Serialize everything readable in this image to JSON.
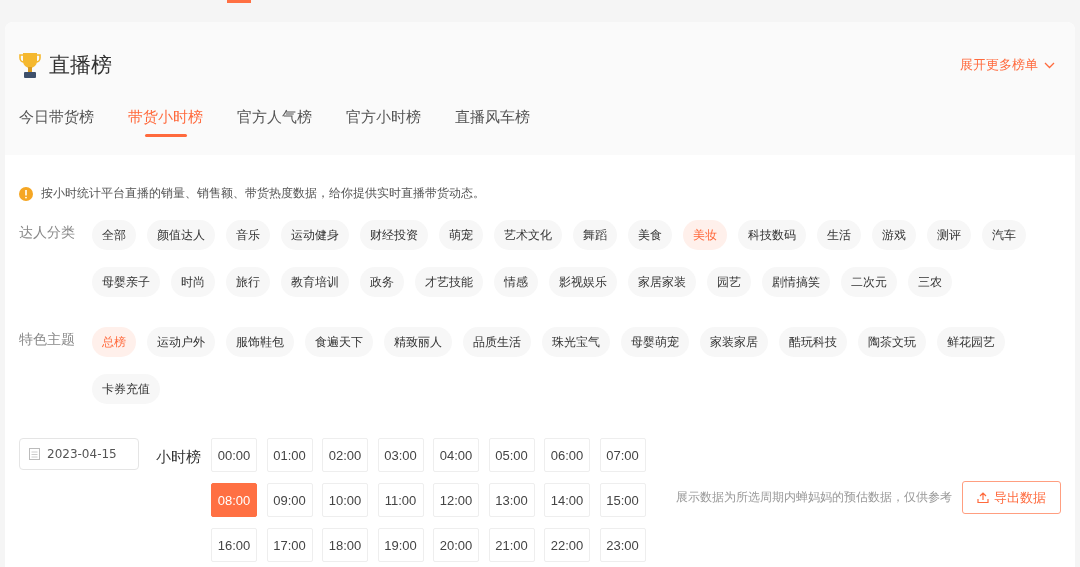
{
  "header": {
    "title": "直播榜",
    "more_link": "展开更多榜单"
  },
  "tabs": [
    {
      "label": "今日带货榜",
      "selected": false
    },
    {
      "label": "带货小时榜",
      "selected": true
    },
    {
      "label": "官方人气榜",
      "selected": false
    },
    {
      "label": "官方小时榜",
      "selected": false
    },
    {
      "label": "直播风车榜",
      "selected": false
    }
  ],
  "notice": "按小时统计平台直播的销量、销售额、带货热度数据，给你提供实时直播带货动态。",
  "filters": [
    {
      "label": "达人分类",
      "options": [
        {
          "label": "全部",
          "selected": false
        },
        {
          "label": "颜值达人",
          "selected": false
        },
        {
          "label": "音乐",
          "selected": false
        },
        {
          "label": "运动健身",
          "selected": false
        },
        {
          "label": "财经投资",
          "selected": false
        },
        {
          "label": "萌宠",
          "selected": false
        },
        {
          "label": "艺术文化",
          "selected": false
        },
        {
          "label": "舞蹈",
          "selected": false
        },
        {
          "label": "美食",
          "selected": false
        },
        {
          "label": "美妆",
          "selected": true
        },
        {
          "label": "科技数码",
          "selected": false
        },
        {
          "label": "生活",
          "selected": false
        },
        {
          "label": "游戏",
          "selected": false
        },
        {
          "label": "测评",
          "selected": false
        },
        {
          "label": "汽车",
          "selected": false
        },
        {
          "label": "母婴亲子",
          "selected": false
        },
        {
          "label": "时尚",
          "selected": false
        },
        {
          "label": "旅行",
          "selected": false
        },
        {
          "label": "教育培训",
          "selected": false
        },
        {
          "label": "政务",
          "selected": false
        },
        {
          "label": "才艺技能",
          "selected": false
        },
        {
          "label": "情感",
          "selected": false
        },
        {
          "label": "影视娱乐",
          "selected": false
        },
        {
          "label": "家居家装",
          "selected": false
        },
        {
          "label": "园艺",
          "selected": false
        },
        {
          "label": "剧情搞笑",
          "selected": false
        },
        {
          "label": "二次元",
          "selected": false
        },
        {
          "label": "三农",
          "selected": false
        }
      ]
    },
    {
      "label": "特色主题",
      "options": [
        {
          "label": "总榜",
          "selected": true
        },
        {
          "label": "运动户外",
          "selected": false
        },
        {
          "label": "服饰鞋包",
          "selected": false
        },
        {
          "label": "食遍天下",
          "selected": false
        },
        {
          "label": "精致丽人",
          "selected": false
        },
        {
          "label": "品质生活",
          "selected": false
        },
        {
          "label": "珠光宝气",
          "selected": false
        },
        {
          "label": "母婴萌宠",
          "selected": false
        },
        {
          "label": "家装家居",
          "selected": false
        },
        {
          "label": "酷玩科技",
          "selected": false
        },
        {
          "label": "陶茶文玩",
          "selected": false
        },
        {
          "label": "鲜花园艺",
          "selected": false
        },
        {
          "label": "卡券充值",
          "selected": false
        }
      ]
    }
  ],
  "date_field": {
    "value": "2023-04-15"
  },
  "hour_label": "小时榜",
  "hours": [
    {
      "label": "00:00",
      "selected": false
    },
    {
      "label": "01:00",
      "selected": false
    },
    {
      "label": "02:00",
      "selected": false
    },
    {
      "label": "03:00",
      "selected": false
    },
    {
      "label": "04:00",
      "selected": false
    },
    {
      "label": "05:00",
      "selected": false
    },
    {
      "label": "06:00",
      "selected": false
    },
    {
      "label": "07:00",
      "selected": false
    },
    {
      "label": "08:00",
      "selected": true
    },
    {
      "label": "09:00",
      "selected": false
    },
    {
      "label": "10:00",
      "selected": false
    },
    {
      "label": "11:00",
      "selected": false
    },
    {
      "label": "12:00",
      "selected": false
    },
    {
      "label": "13:00",
      "selected": false
    },
    {
      "label": "14:00",
      "selected": false
    },
    {
      "label": "15:00",
      "selected": false
    },
    {
      "label": "16:00",
      "selected": false
    },
    {
      "label": "17:00",
      "selected": false
    },
    {
      "label": "18:00",
      "selected": false
    },
    {
      "label": "19:00",
      "selected": false
    },
    {
      "label": "20:00",
      "selected": false
    },
    {
      "label": "21:00",
      "selected": false
    },
    {
      "label": "22:00",
      "selected": false
    },
    {
      "label": "23:00",
      "selected": false
    }
  ],
  "disclaimer": "展示数据为所选周期内蝉妈妈的预估数据，仅供参考",
  "export_button": "导出数据"
}
